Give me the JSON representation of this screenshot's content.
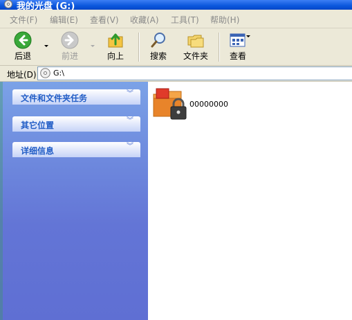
{
  "window": {
    "title": "我的光盘 (G:)"
  },
  "menu": [
    "文件(F)",
    "编辑(E)",
    "查看(V)",
    "收藏(A)",
    "工具(T)",
    "帮助(H)"
  ],
  "toolbar": {
    "back": "后退",
    "forward": "前进",
    "up": "向上",
    "search": "搜索",
    "folders": "文件夹",
    "views": "查看"
  },
  "address": {
    "label": "地址(D)",
    "value": "G:\\"
  },
  "tasks": [
    {
      "title": "文件和文件夹任务"
    },
    {
      "title": "其它位置"
    },
    {
      "title": "详细信息"
    }
  ],
  "files": [
    {
      "name": "00000000",
      "icon": "locked-folder-icon"
    }
  ]
}
